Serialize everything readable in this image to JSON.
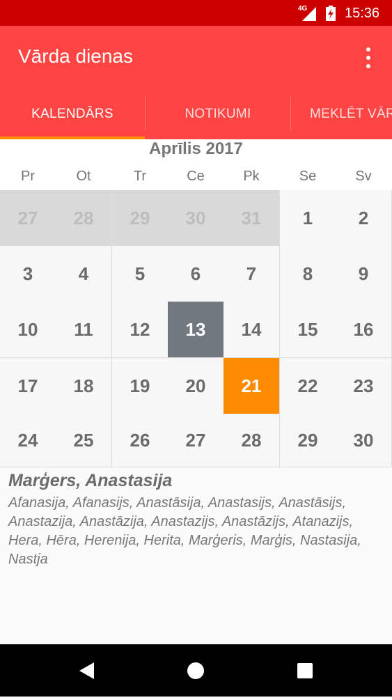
{
  "status_bar": {
    "network": "4G",
    "time": "15:36"
  },
  "app": {
    "title": "Vārda dienas",
    "menu_icon": "overflow-menu-icon"
  },
  "tabs": [
    {
      "label": "KALENDĀRS",
      "selected": true
    },
    {
      "label": "NOTIKUMI",
      "selected": false
    },
    {
      "label": "MEKLĒT VĀRDU",
      "selected": false
    }
  ],
  "calendar": {
    "month_label": "Aprīlis 2017",
    "weekdays": [
      "Pr",
      "Ot",
      "Tr",
      "Ce",
      "Pk",
      "Se",
      "Sv"
    ],
    "weeks": [
      [
        "27",
        "28",
        "29",
        "30",
        "31",
        "1",
        "2"
      ],
      [
        "3",
        "4",
        "5",
        "6",
        "7",
        "8",
        "9"
      ],
      [
        "10",
        "11",
        "12",
        "13",
        "14",
        "15",
        "16"
      ],
      [
        "17",
        "18",
        "19",
        "20",
        "21",
        "22",
        "23"
      ],
      [
        "24",
        "25",
        "26",
        "27",
        "28",
        "29",
        "30"
      ]
    ],
    "outside_month_count": 5,
    "selected_day": "13",
    "today_day": "21",
    "colors": {
      "selected": "#717880",
      "today": "#ff8c00",
      "outside": "#d9d9d9"
    }
  },
  "names": {
    "primary": "Marģers, Anastasija",
    "others": "Afanasija, Afanasijs, Anastāsija, Anastasijs, Anastāsijs, Anastazija, Anastāzija, Anastazijs, Anastāzijs, Atanazijs, Hera, Hēra, Herenija, Herita, Marģeris, Marģis, Nastasija, Nastja"
  },
  "nav_bar": {
    "back": "back-icon",
    "home": "home-icon",
    "recents": "recents-icon"
  },
  "theme": {
    "status_bar": "#cc0000",
    "app_bar": "#ff4444",
    "accent": "#ff8c00"
  }
}
